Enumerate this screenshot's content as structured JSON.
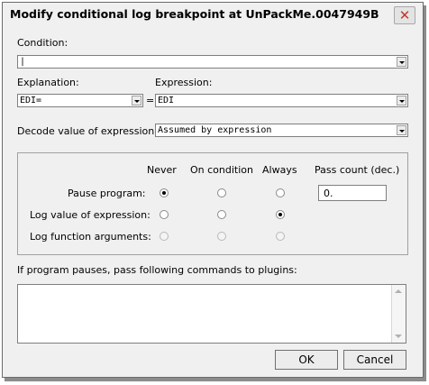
{
  "window": {
    "title": "Modify conditional log breakpoint at UnPackMe.0047949B",
    "close_glyph": "✕"
  },
  "condition": {
    "label": "Condition:",
    "value": "|"
  },
  "explanation": {
    "label": "Explanation:",
    "value": "EDI="
  },
  "equals_sign": "=",
  "expression": {
    "label": "Expression:",
    "value": "EDI"
  },
  "decode": {
    "label": "Decode value of expression as:",
    "value": "Assumed by expression"
  },
  "options": {
    "columns": [
      "Never",
      "On condition",
      "Always",
      "Pass count (dec.)"
    ],
    "rows": [
      {
        "label": "Pause program:",
        "selected": "Never",
        "disabled": false
      },
      {
        "label": "Log value of expression:",
        "selected": "Always",
        "disabled": false
      },
      {
        "label": "Log function arguments:",
        "selected": "",
        "disabled": true
      }
    ],
    "pass_count": "0."
  },
  "plugins": {
    "label": "If program pauses, pass following commands to plugins:",
    "value": ""
  },
  "buttons": {
    "ok": "OK",
    "cancel": "Cancel"
  }
}
